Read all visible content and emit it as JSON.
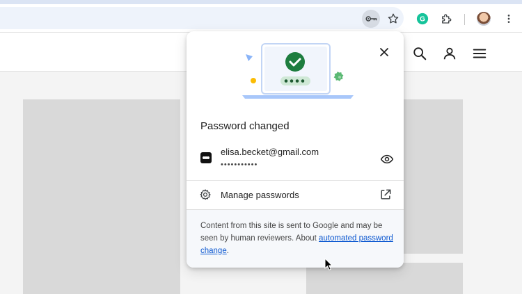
{
  "popup": {
    "title": "Password changed",
    "credential": {
      "email": "elisa.becket@gmail.com",
      "password_mask": "•••••••••••"
    },
    "manage_label": "Manage passwords",
    "footer": {
      "text_before": "Content from this site is sent to Google and may be seen by human reviewers. About ",
      "link_text": "automated password change",
      "text_after": "."
    }
  },
  "toolbar": {
    "extension_letter": "G"
  },
  "colors": {
    "accent_blue": "#0b57d0",
    "success_green": "#1e7d3f",
    "key_button_bg": "#d6dbe3"
  },
  "icons": [
    "key-icon",
    "star-icon",
    "grammarly-icon",
    "puzzle-icon",
    "avatar",
    "kebab-menu-icon",
    "search-icon",
    "account-icon",
    "hamburger-menu-icon",
    "close-icon",
    "site-favicon-icon",
    "eye-icon",
    "gear-icon",
    "external-link-icon",
    "cursor-icon"
  ]
}
